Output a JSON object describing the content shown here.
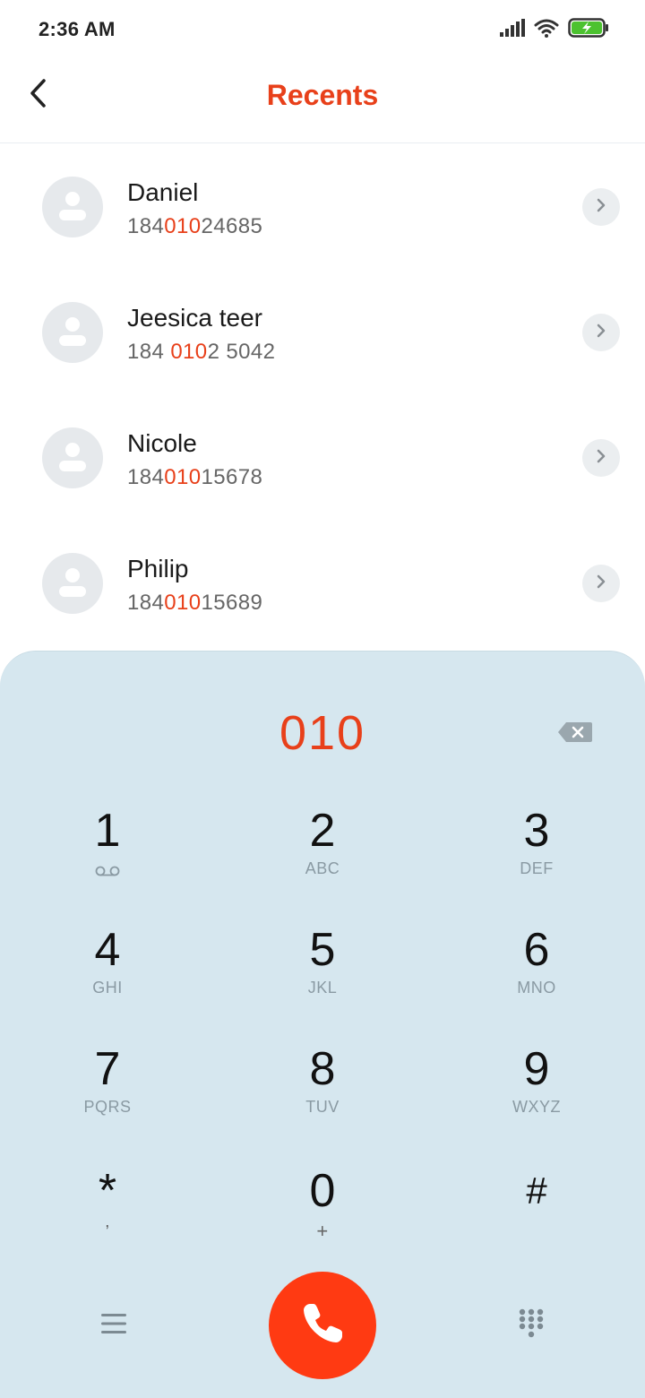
{
  "status_bar": {
    "time": "2:36 AM",
    "icons": [
      "signal-icon",
      "wifi-icon",
      "battery-charging-icon"
    ],
    "battery_color": "#4cc230"
  },
  "header": {
    "title": "Recents",
    "back_icon": "chevron-left-icon"
  },
  "accent_color": "#e8401a",
  "results": [
    {
      "name": "Daniel",
      "number_before": "184",
      "number_match": "010",
      "number_after": "24685"
    },
    {
      "name": "Jeesica teer",
      "number_before": "184 ",
      "number_match": "010",
      "number_after": "2 5042"
    },
    {
      "name": "Nicole",
      "number_before": "184",
      "number_match": "010",
      "number_after": "15678"
    },
    {
      "name": "Philip",
      "number_before": "184",
      "number_match": "010",
      "number_after": "15689"
    }
  ],
  "dialer": {
    "dialed_number": "010",
    "keys": [
      {
        "digit": "1",
        "letters": ""
      },
      {
        "digit": "2",
        "letters": "ABC"
      },
      {
        "digit": "3",
        "letters": "DEF"
      },
      {
        "digit": "4",
        "letters": "GHI"
      },
      {
        "digit": "5",
        "letters": "JKL"
      },
      {
        "digit": "6",
        "letters": "MNO"
      },
      {
        "digit": "7",
        "letters": "PQRS"
      },
      {
        "digit": "8",
        "letters": "TUV"
      },
      {
        "digit": "9",
        "letters": "WXYZ"
      },
      {
        "digit": "*",
        "letters": ","
      },
      {
        "digit": "0",
        "letters": "+"
      },
      {
        "digit": "#",
        "letters": ""
      }
    ],
    "call_button_color": "#ff3a12",
    "panel_color": "#d6e7ef"
  }
}
